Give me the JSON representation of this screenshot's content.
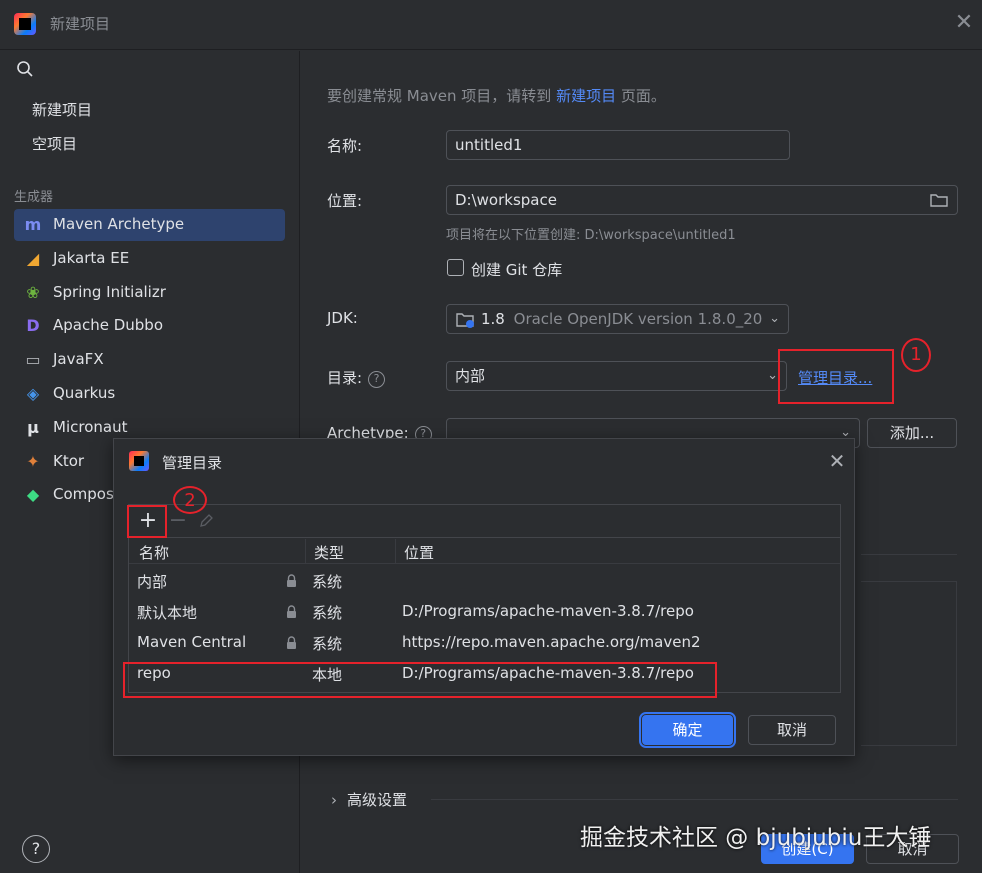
{
  "window": {
    "title": "新建项目"
  },
  "sidebar": {
    "nav": [
      "新建项目",
      "空项目"
    ],
    "section_label": "生成器",
    "generators": [
      {
        "label": "Maven Archetype",
        "icon": "maven-icon",
        "glyph": "m",
        "color": "#7b8cf2"
      },
      {
        "label": "Jakarta EE",
        "icon": "jakarta-icon",
        "glyph": "◢",
        "color": "#f0a732"
      },
      {
        "label": "Spring Initializr",
        "icon": "spring-icon",
        "glyph": "❀",
        "color": "#6db33f"
      },
      {
        "label": "Apache Dubbo",
        "icon": "dubbo-icon",
        "glyph": "D",
        "color": "#8a6cf0"
      },
      {
        "label": "JavaFX",
        "icon": "folder-icon",
        "glyph": "▭",
        "color": "#aeb1b6"
      },
      {
        "label": "Quarkus",
        "icon": "quarkus-icon",
        "glyph": "◈",
        "color": "#4695eb"
      },
      {
        "label": "Micronaut",
        "icon": "micronaut-icon",
        "glyph": "μ",
        "color": "#dfe1e5"
      },
      {
        "label": "Ktor",
        "icon": "ktor-icon",
        "glyph": "✦",
        "color": "#e0803a"
      },
      {
        "label": "Compos",
        "icon": "compose-icon",
        "glyph": "◆",
        "color": "#3ddc84"
      }
    ]
  },
  "form": {
    "hint_prefix": "要创建常规 Maven 项目，请转到 ",
    "hint_link": "新建项目",
    "hint_suffix": " 页面。",
    "name_label": "名称:",
    "name_value": "untitled1",
    "location_label": "位置:",
    "location_value": "D:\\workspace",
    "location_note": "项目将在以下位置创建: D:\\workspace\\untitled1",
    "git_label": "创建 Git 仓库",
    "jdk_label": "JDK:",
    "jdk_version": "1.8",
    "jdk_detail": "Oracle OpenJDK version 1.8.0_20",
    "catalog_label": "目录:",
    "catalog_value": "内部",
    "manage_link": "管理目录...",
    "archetype_label": "Archetype:",
    "add_button": "添加...",
    "advanced_label": "高级设置",
    "create_button": "创建(C)",
    "cancel_button": "取消"
  },
  "annotations": {
    "one": "1",
    "two": "2"
  },
  "dialog": {
    "title": "管理目录",
    "columns": [
      "名称",
      "类型",
      "位置"
    ],
    "rows": [
      {
        "name": "内部",
        "type": "系统",
        "location": "",
        "locked": true
      },
      {
        "name": "默认本地",
        "type": "系统",
        "location": "D:/Programs/apache-maven-3.8.7/repo",
        "locked": true
      },
      {
        "name": "Maven Central",
        "type": "系统",
        "location": "https://repo.maven.apache.org/maven2",
        "locked": true
      },
      {
        "name": "repo",
        "type": "本地",
        "location": "D:/Programs/apache-maven-3.8.7/repo",
        "locked": false
      }
    ],
    "ok_button": "确定",
    "cancel_button": "取消"
  },
  "watermark": "掘金技术社区 @ bjubjubiu王大锤"
}
